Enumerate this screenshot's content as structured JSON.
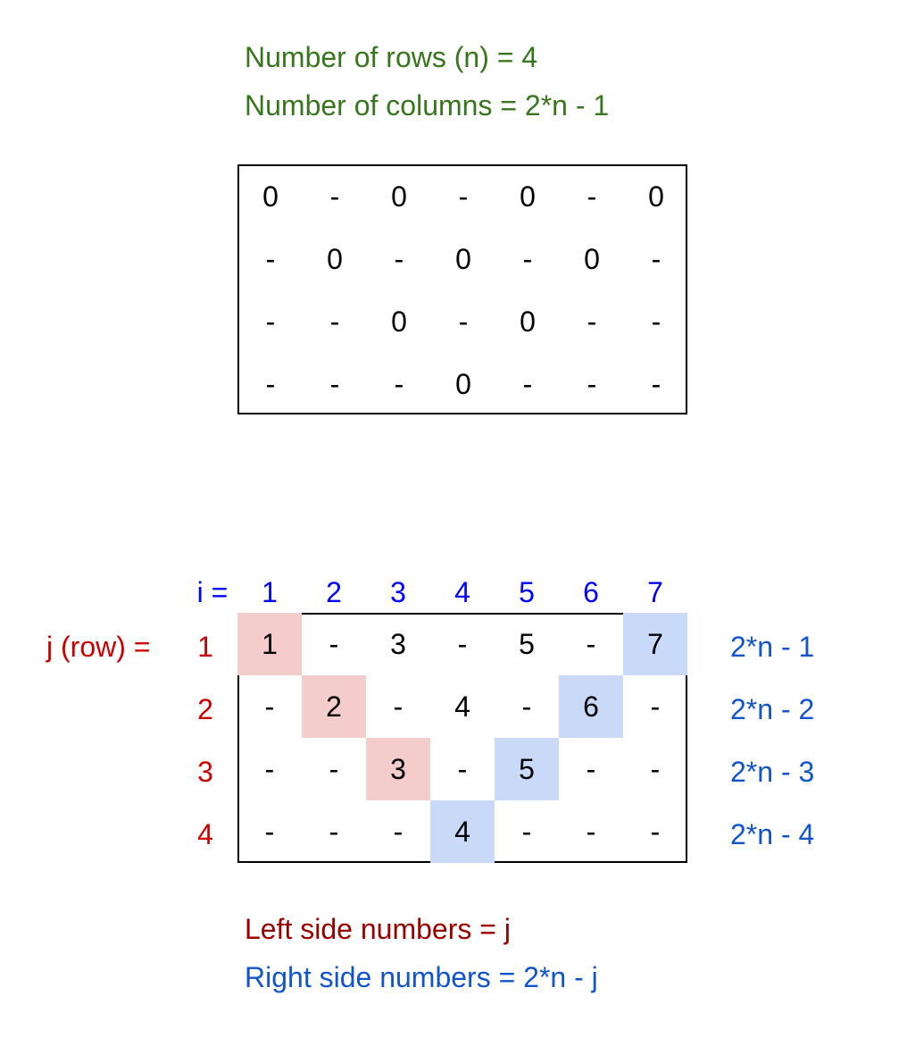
{
  "header": {
    "rows_text": "Number of rows (n) = 4",
    "cols_text": "Number of columns = 2*n - 1"
  },
  "grid1": {
    "rows": [
      [
        "0",
        "-",
        "0",
        "-",
        "0",
        "-",
        "0"
      ],
      [
        "-",
        "0",
        "-",
        "0",
        "-",
        "0",
        "-"
      ],
      [
        "-",
        "-",
        "0",
        "-",
        "0",
        "-",
        "-"
      ],
      [
        "-",
        "-",
        "-",
        "0",
        "-",
        "-",
        "-"
      ]
    ]
  },
  "grid2": {
    "i_label": "i =",
    "i_values": [
      "1",
      "2",
      "3",
      "4",
      "5",
      "6",
      "7"
    ],
    "j_label": "j (row) =",
    "j_values": [
      "1",
      "2",
      "3",
      "4"
    ],
    "rows": [
      [
        {
          "v": "1",
          "f": "pink"
        },
        {
          "v": "-",
          "f": ""
        },
        {
          "v": "3",
          "f": ""
        },
        {
          "v": "-",
          "f": ""
        },
        {
          "v": "5",
          "f": ""
        },
        {
          "v": "-",
          "f": ""
        },
        {
          "v": "7",
          "f": "blue"
        }
      ],
      [
        {
          "v": "-",
          "f": ""
        },
        {
          "v": "2",
          "f": "pink"
        },
        {
          "v": "-",
          "f": ""
        },
        {
          "v": "4",
          "f": ""
        },
        {
          "v": "-",
          "f": ""
        },
        {
          "v": "6",
          "f": "blue"
        },
        {
          "v": "-",
          "f": ""
        }
      ],
      [
        {
          "v": "-",
          "f": ""
        },
        {
          "v": "-",
          "f": ""
        },
        {
          "v": "3",
          "f": "pink"
        },
        {
          "v": "-",
          "f": ""
        },
        {
          "v": "5",
          "f": "blue"
        },
        {
          "v": "-",
          "f": ""
        },
        {
          "v": "-",
          "f": ""
        }
      ],
      [
        {
          "v": "-",
          "f": ""
        },
        {
          "v": "-",
          "f": ""
        },
        {
          "v": "-",
          "f": ""
        },
        {
          "v": "4",
          "f": "blue"
        },
        {
          "v": "-",
          "f": ""
        },
        {
          "v": "-",
          "f": ""
        },
        {
          "v": "-",
          "f": ""
        }
      ]
    ],
    "right_labels": [
      "2*n - 1",
      "2*n - 2",
      "2*n - 3",
      "2*n - 4"
    ]
  },
  "footer": {
    "left_text": "Left side numbers = j",
    "right_text": "Right side numbers = 2*n - j"
  },
  "colors": {
    "pink": "#f4cccc",
    "blue": "#c9daf8",
    "green_text": "#38761d",
    "red_text": "#cc0000",
    "dark_red_text": "#990000",
    "blue_text": "#0000ff",
    "light_blue_text": "#1155cc"
  }
}
